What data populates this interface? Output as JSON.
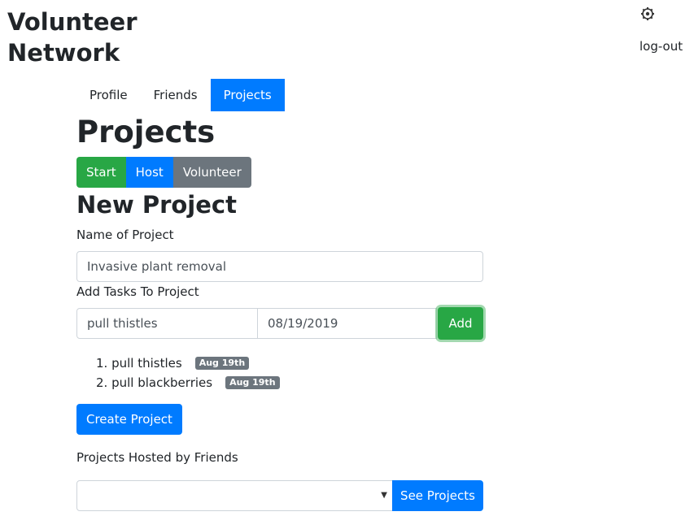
{
  "header": {
    "brand_line1": "Volunteer",
    "brand_line2": "Network",
    "logout_label": "log-out",
    "settings_icon": "gear-icon"
  },
  "tabs": [
    {
      "label": "Profile",
      "active": false
    },
    {
      "label": "Friends",
      "active": false
    },
    {
      "label": "Projects",
      "active": true
    }
  ],
  "page_title": "Projects",
  "mode_buttons": [
    {
      "label": "Start",
      "color": "#28a745"
    },
    {
      "label": "Host",
      "color": "#007bff"
    },
    {
      "label": "Volunteer",
      "color": "#6c757d"
    }
  ],
  "form": {
    "title": "New Project",
    "name_label": "Name of Project",
    "name_value": "Invasive plant removal",
    "tasks_label": "Add Tasks To Project",
    "task_value": "pull thistles",
    "date_value": "08/19/2019",
    "add_label": "Add",
    "tasks": [
      {
        "number": "1.",
        "name": "pull thistles",
        "date": "Aug 19th"
      },
      {
        "number": "2.",
        "name": "pull blackberries",
        "date": "Aug 19th"
      }
    ],
    "create_label": "Create Project"
  },
  "friends_projects": {
    "label": "Projects Hosted by Friends",
    "selected": "",
    "button_label": "See Projects"
  },
  "colors": {
    "primary": "#007bff",
    "success": "#28a745",
    "secondary": "#6c757d"
  }
}
